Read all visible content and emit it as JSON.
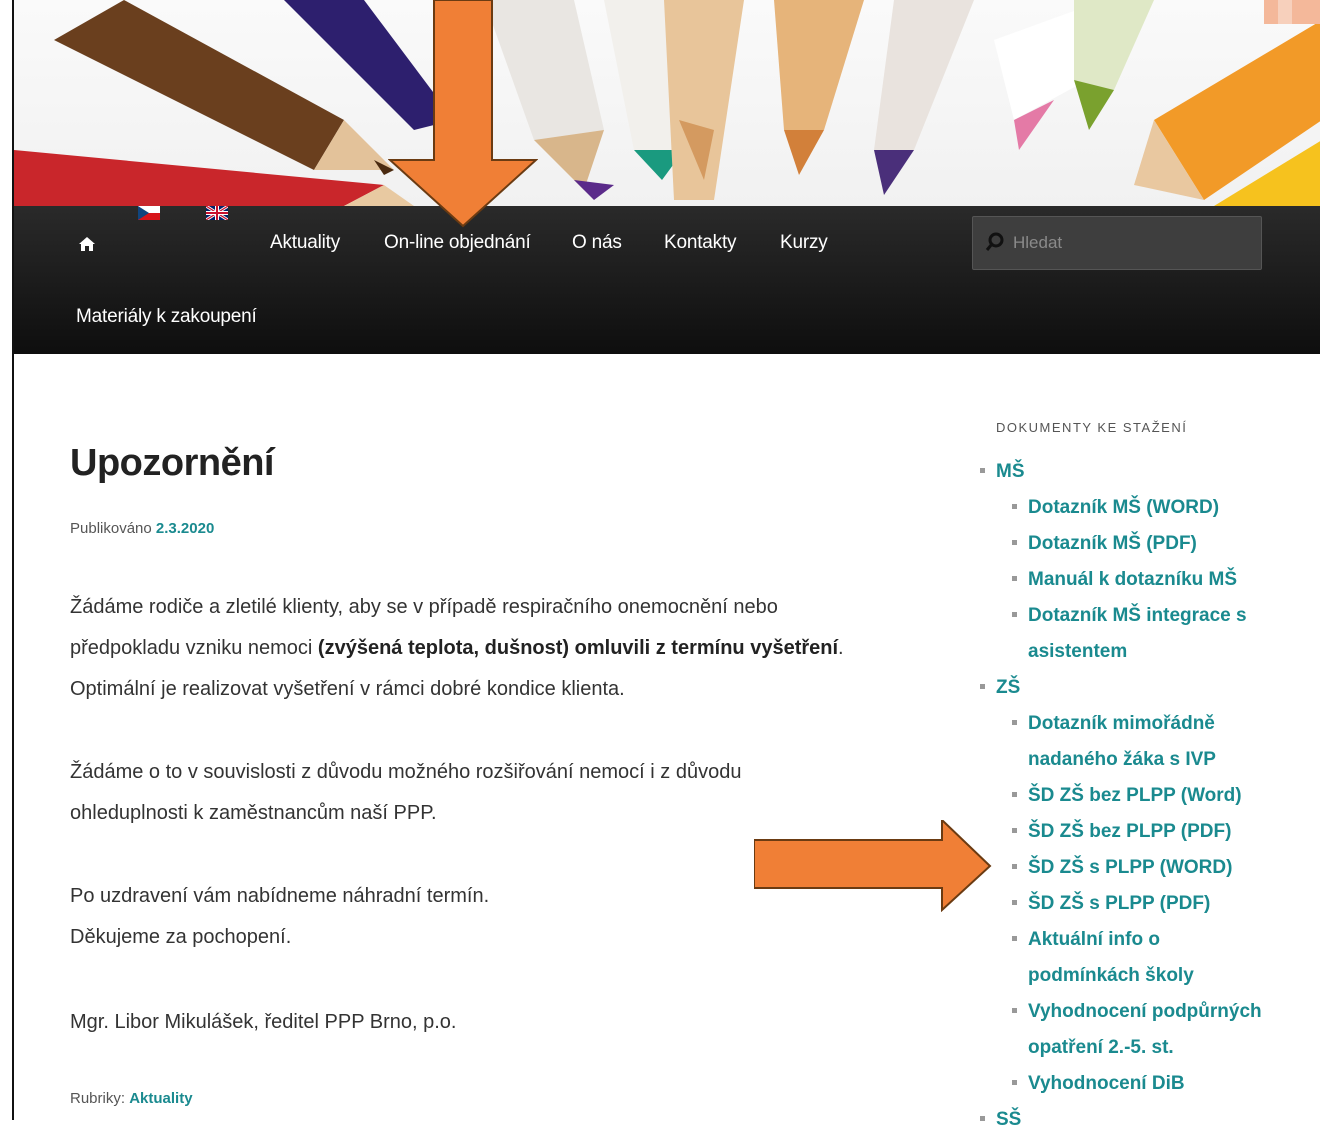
{
  "nav": {
    "home_icon": "home-icon",
    "flags": [
      "czech-flag-icon",
      "uk-flag-icon"
    ],
    "items": [
      "Aktuality",
      "On-line objednání",
      "O nás",
      "Kontakty",
      "Kurzy",
      "Materiály k zakoupení"
    ],
    "search_placeholder": "Hledat"
  },
  "post": {
    "title": "Upozornění",
    "published_label": "Publikováno",
    "published_date": "2.3.2020",
    "p1_a": "Žádáme rodiče a zletilé klienty, aby se v případě respiračního onemocnění nebo předpokladu vzniku nemoci ",
    "p1_b": "(zvýšená teplota, dušnost) omluvili z termínu vyšetření",
    "p1_c": ". Optimální je realizovat vyšetření v rámci dobré kondice klienta.",
    "p2": "Žádáme o to v souvislosti  z důvodu možného rozšiřování nemocí i z důvodu ohleduplnosti k zaměstnancům naší PPP.",
    "p3_a": "Po uzdravení vám nabídneme náhradní termín.",
    "p3_b": "Děkujeme za pochopení.",
    "p4": "Mgr. Libor Mikulášek, ředitel PPP Brno, p.o.",
    "category_label": "Rubriky:",
    "category": "Aktuality"
  },
  "sidebar": {
    "title": "DOKUMENTY KE STAŽENÍ",
    "rows": [
      "MŠ",
      "Dotazník MŠ (WORD)",
      "Dotazník MŠ (PDF)",
      "Manuál k dotazníku MŠ",
      "Dotazník MŠ integrace s",
      "asistentem",
      "ZŠ",
      "Dotazník mimořádně",
      "nadaného žáka s IVP",
      "ŠD ZŠ bez PLPP (Word)",
      "ŠD ZŠ bez PLPP (PDF)",
      "ŠD ZŠ s PLPP (WORD)",
      "ŠD ZŠ s PLPP (PDF)",
      "Aktuální info o",
      "podmínkách školy",
      "Vyhodnocení podpůrných",
      "opatření 2.-5. st.",
      "Vyhodnocení DiB",
      "SŠ"
    ]
  },
  "colors": {
    "accent_link": "#1a8a8f",
    "annotation_arrow": "#f07f36",
    "nav_bg": "#111111"
  }
}
